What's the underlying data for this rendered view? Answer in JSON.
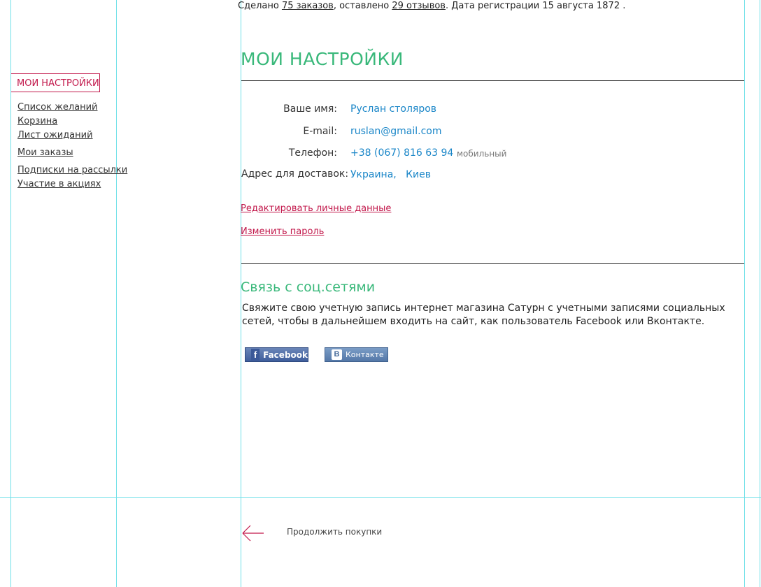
{
  "stats": {
    "prefix": "Сделано ",
    "orders_link": "75 заказов",
    "middle": ", оставлено ",
    "reviews_link": "29 отзывов",
    "suffix": ". Дата регистрации 15 августа 1872 ."
  },
  "sidebar": {
    "title": "МОИ НАСТРОЙКИ",
    "items": [
      {
        "label": "Список желаний"
      },
      {
        "label": "Корзина"
      },
      {
        "label": "Лист ожиданий"
      },
      {
        "label": "Мои заказы"
      },
      {
        "label": "Подписки на рассылки"
      },
      {
        "label": "Участие в акциях"
      }
    ]
  },
  "main": {
    "title": "МОИ  НАСТРОЙКИ",
    "fields": [
      {
        "label": "Ваше имя:",
        "value": "Руслан столяров"
      },
      {
        "label": "E-mail:",
        "value": "ruslan@gmail.com"
      },
      {
        "label": "Телефон:",
        "value": "+38 (067) 816 63 94",
        "note": "мобильный"
      },
      {
        "label": "Адрес для доставок:",
        "value": "Украина,   Киев"
      }
    ],
    "edit_link": "Редактировать личные данные",
    "password_link": "Изменить пароль"
  },
  "social": {
    "title": "Связь с соц.сетями",
    "text": "Свяжите свою учетную запись  интернет магазина Сатурн с учетными записями  социальных сетей, чтобы в дальнейшем входить на сайт, как пользователь Facebook или Вконтакте.",
    "facebook": {
      "icon": "facebook-icon",
      "label": "Facebook",
      "glyph": "f"
    },
    "vk": {
      "icon": "vk-icon",
      "label": "Контакте",
      "glyph": "B"
    }
  },
  "footer": {
    "arrow_icon": "arrow-left-icon",
    "continue_label": "Продолжить покупки"
  },
  "colors": {
    "accent_green": "#39b87a",
    "accent_red": "#c2184b",
    "link_blue": "#1a86c8",
    "guide": "#6fe0e8"
  }
}
